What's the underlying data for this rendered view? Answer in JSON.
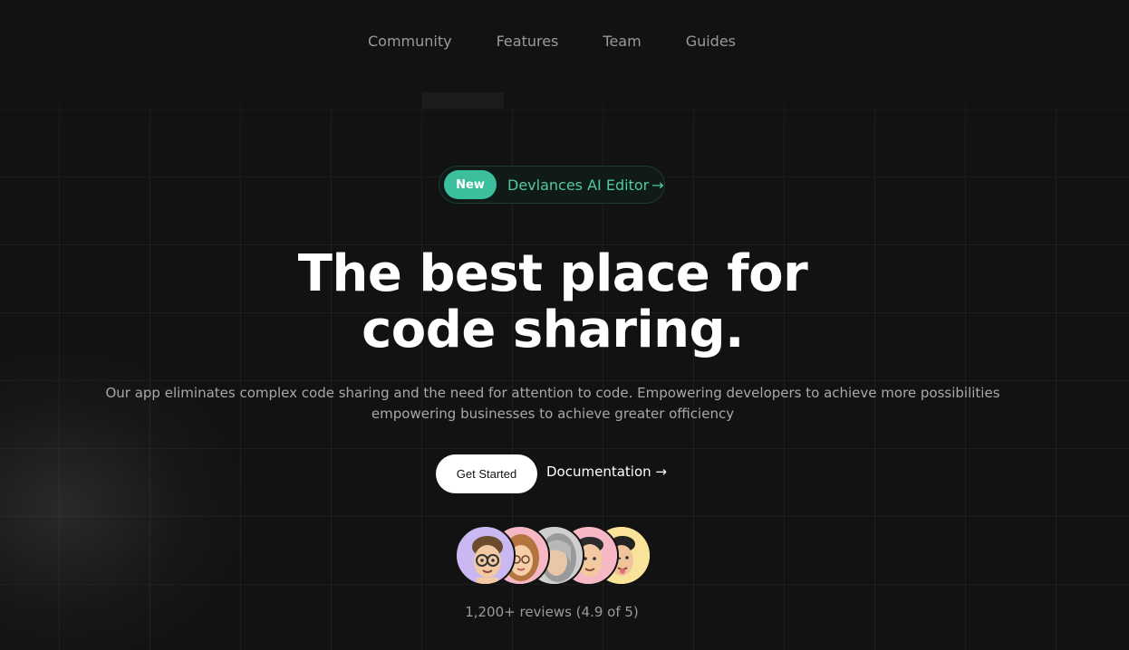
{
  "nav": {
    "items": [
      "Community",
      "Features",
      "Team",
      "Guides"
    ]
  },
  "announcement": {
    "badge": "New",
    "label": "Devlances AI Editor",
    "arrow": "→"
  },
  "hero": {
    "title_line1": "The best place for",
    "title_line2": "code sharing.",
    "subtitle_line1": "Our app eliminates complex code sharing and the need for attention to code. Empowering developers to achieve more possibilities",
    "subtitle_line2": "empowering businesses to achieve greater officiency"
  },
  "actions": {
    "primary_label": "Get Started",
    "secondary_label": "Documentation →"
  },
  "social_proof": {
    "avatars": [
      {
        "icon": "memoji-glasses-avatar",
        "bg": "#c9b8f2"
      },
      {
        "icon": "memoji-woman-avatar",
        "bg": "#f6b8c4"
      },
      {
        "icon": "memoji-grey-hair-avatar",
        "bg": "#cfcfcf"
      },
      {
        "icon": "memoji-man-avatar",
        "bg": "#f6b8c4"
      },
      {
        "icon": "memoji-tongue-avatar",
        "bg": "#f9e39a"
      }
    ],
    "reviews": "1,200+ reviews (4.9 of 5)"
  },
  "colors": {
    "background": "#121212",
    "accent": "#3bbf9d",
    "accent_text": "#4fcaa4",
    "muted_text": "#9a9a9a"
  }
}
